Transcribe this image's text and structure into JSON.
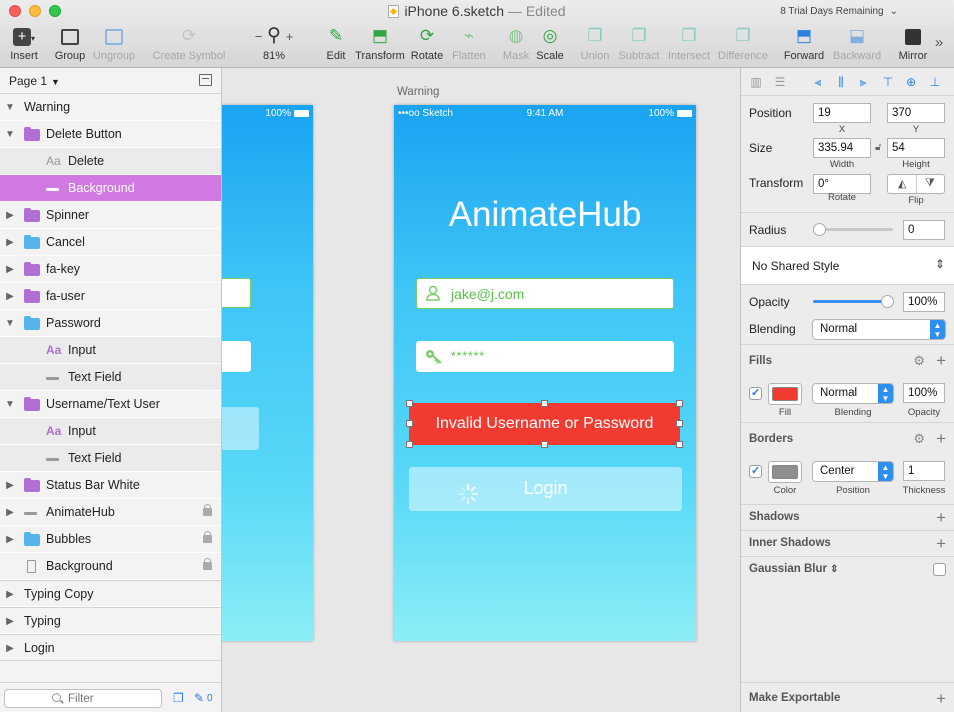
{
  "window": {
    "title": "iPhone 6.sketch",
    "title_suffix": "— Edited",
    "trial": "8 Trial Days Remaining"
  },
  "toolbar": {
    "insert": "Insert",
    "group": "Group",
    "ungroup": "Ungroup",
    "create_symbol": "Create Symbol",
    "zoom": "81%",
    "zoom_minus": "−",
    "zoom_plus": "+",
    "edit": "Edit",
    "transform": "Transform",
    "rotate": "Rotate",
    "flatten": "Flatten",
    "mask": "Mask",
    "scale": "Scale",
    "union": "Union",
    "subtract": "Subtract",
    "intersect": "Intersect",
    "difference": "Difference",
    "forward": "Forward",
    "backward": "Backward",
    "mirror": "Mirror",
    "more": "»"
  },
  "sidebar": {
    "page": "Page 1",
    "filter_placeholder": "Filter",
    "edit_count": "0",
    "layers": [
      {
        "name": "Warning"
      },
      {
        "name": "Delete Button"
      },
      {
        "name": "Delete"
      },
      {
        "name": "Background"
      },
      {
        "name": "Spinner"
      },
      {
        "name": "Cancel"
      },
      {
        "name": "fa-key"
      },
      {
        "name": "fa-user"
      },
      {
        "name": "Password"
      },
      {
        "name": "Input"
      },
      {
        "name": "Text Field"
      },
      {
        "name": "Username/Text User"
      },
      {
        "name": "Input"
      },
      {
        "name": "Text Field"
      },
      {
        "name": "Status Bar White"
      },
      {
        "name": "AnimateHub"
      },
      {
        "name": "Bubbles"
      },
      {
        "name": "Background"
      },
      {
        "name": "Typing Copy"
      },
      {
        "name": "Typing"
      },
      {
        "name": "Login"
      }
    ]
  },
  "canvas": {
    "artboard_label": "Warning",
    "status_left": "•••oo Sketch",
    "status_time": "9:41 AM",
    "status_battery": "100%",
    "left_battery": "100%",
    "app_title": "AnimateHub",
    "left_app_title": "ub",
    "username": "jake@j.com",
    "password": "******",
    "error": "Invalid Username or Password",
    "login": "Login"
  },
  "inspector": {
    "position_label": "Position",
    "x": "19",
    "y": "370",
    "x_label": "X",
    "y_label": "Y",
    "size_label": "Size",
    "width": "335.94",
    "height": "54",
    "width_label": "Width",
    "height_label": "Height",
    "transform_label": "Transform",
    "rotate": "0°",
    "rotate_label": "Rotate",
    "flip_label": "Flip",
    "radius_label": "Radius",
    "radius": "0",
    "shared_style": "No Shared Style",
    "opacity_label": "Opacity",
    "opacity": "100%",
    "blending_label": "Blending",
    "blending": "Normal",
    "fills_head": "Fills",
    "fill_blending": "Normal",
    "fill_opacity": "100%",
    "fill_label": "Fill",
    "fill_blending_label": "Blending",
    "fill_opacity_label": "Opacity",
    "fill_color": "#f23b30",
    "borders_head": "Borders",
    "border_position": "Center",
    "border_thickness": "1",
    "border_color_label": "Color",
    "border_position_label": "Position",
    "border_thickness_label": "Thickness",
    "border_color": "#8e8e8e",
    "shadows_head": "Shadows",
    "inner_shadows_head": "Inner Shadows",
    "gaussian_blur_head": "Gaussian Blur",
    "make_exportable": "Make Exportable"
  }
}
